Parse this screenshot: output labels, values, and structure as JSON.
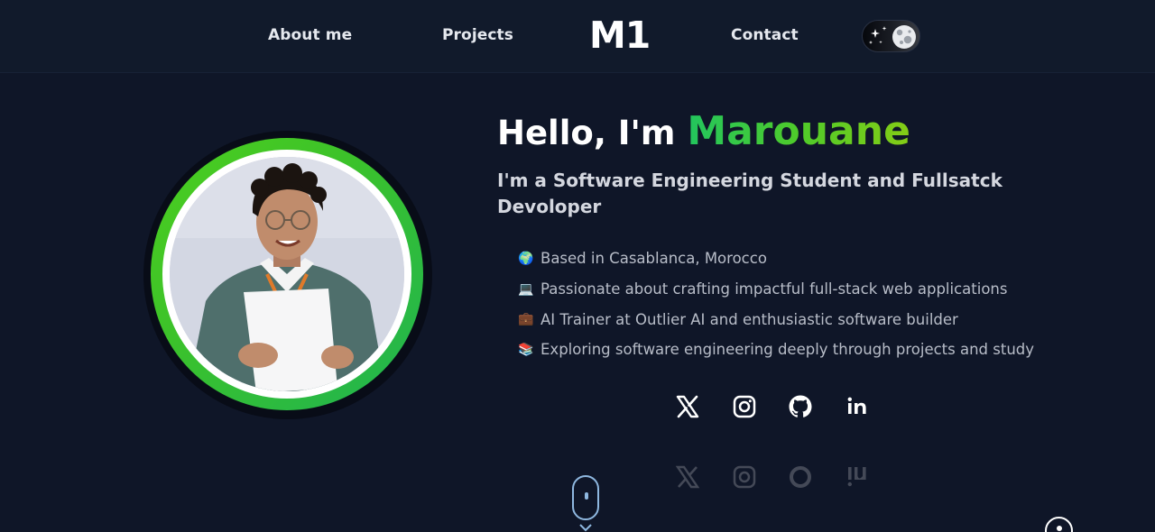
{
  "nav": {
    "about": "About me",
    "projects": "Projects",
    "logo": "M1",
    "contact": "Contact"
  },
  "hero": {
    "greeting_prefix": "Hello, I'm",
    "name": "Marouane",
    "subtitle": "I'm a Software Engineering Student and Fullsatck Devoloper",
    "bullets": [
      {
        "emoji": "🌍",
        "text": "Based in Casablanca, Morocco"
      },
      {
        "emoji": "💻",
        "text": "Passionate about crafting impactful full-stack web applications"
      },
      {
        "emoji": "💼",
        "text": "AI Trainer at Outlier AI and enthusiastic software builder"
      },
      {
        "emoji": "📚",
        "text": "Exploring software engineering deeply through projects and study"
      }
    ]
  },
  "social": [
    "x-icon",
    "instagram-icon",
    "github-icon",
    "linkedin-icon"
  ],
  "colors": {
    "background": "#0f1628",
    "navbar": "#111a2b",
    "accent_green": "#4fcb2a",
    "scroll_indicator": "#8fb8e0"
  }
}
